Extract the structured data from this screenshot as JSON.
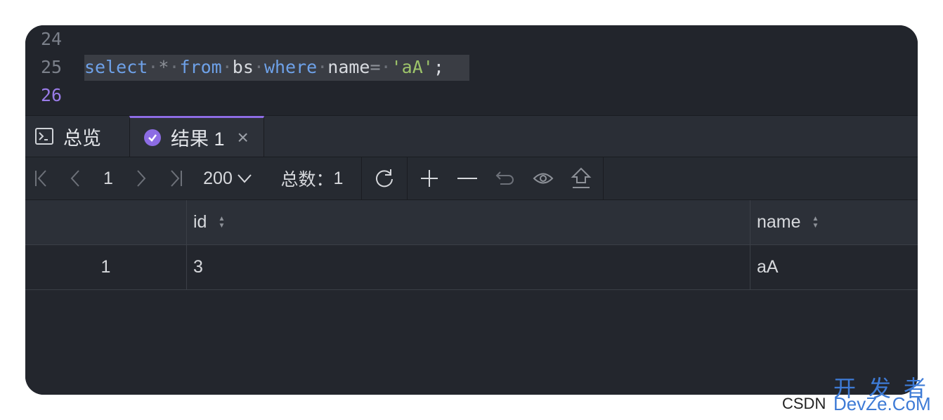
{
  "editor": {
    "lines": [
      {
        "number": "24",
        "text": ""
      },
      {
        "number": "25",
        "text": "select * from bs where name= 'aA';"
      },
      {
        "number": "26",
        "text": ""
      }
    ]
  },
  "tabs": [
    {
      "label": "总览",
      "icon": "terminal-icon"
    },
    {
      "label": "结果 1",
      "icon": "check-circle-icon",
      "active": true,
      "closable": true
    }
  ],
  "toolbar": {
    "page": "1",
    "page_size": "200",
    "total_label": "总数：",
    "total_value": "1",
    "actions": [
      "first-page",
      "prev-page",
      "next-page",
      "last-page",
      "refresh",
      "add-row",
      "delete-row",
      "undo",
      "preview",
      "upload"
    ]
  },
  "grid": {
    "columns": [
      "id",
      "name"
    ],
    "rows": [
      {
        "index": "1",
        "id": "3",
        "name": "aA"
      }
    ]
  },
  "watermark": {
    "cn": "开发者",
    "csdn": "CSDN",
    "site": "DevZe.CoM"
  },
  "colors": {
    "accent": "#8c6ce4",
    "keyword": "#6ea1e8",
    "string": "#9dc46a",
    "background": "#22252c"
  }
}
